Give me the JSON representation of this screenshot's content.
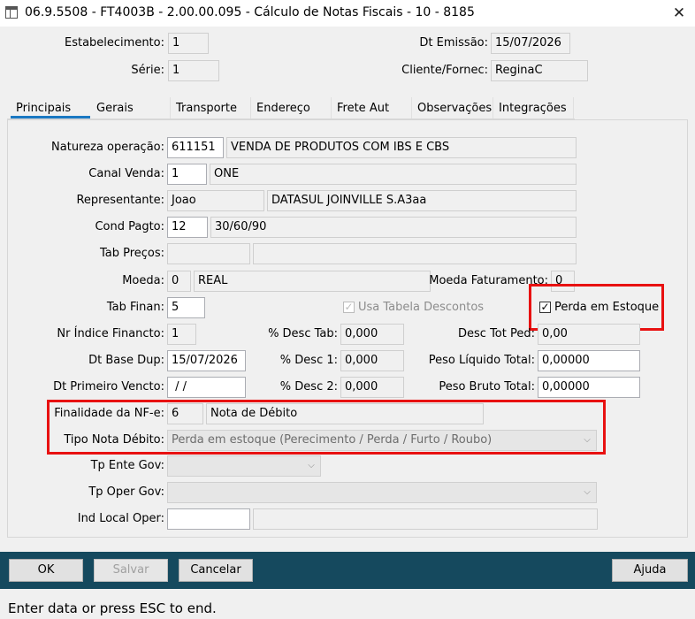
{
  "window": {
    "title": "06.9.5508 - FT4003B - 2.00.00.095 - Cálculo de Notas Fiscais - 10 - 8185",
    "close_glyph": "✕"
  },
  "header": {
    "estabelecimento_label": "Estabelecimento:",
    "estabelecimento": "1",
    "serie_label": "Série:",
    "serie": "1",
    "dt_emissao_label": "Dt Emissão:",
    "dt_emissao": "15/07/2026",
    "cliente_label": "Cliente/Fornec:",
    "cliente": "ReginaC"
  },
  "tabs": [
    "Principais",
    "Gerais",
    "Transporte",
    "Endereço",
    "Frete Aut",
    "Observações",
    "Integrações"
  ],
  "form": {
    "natureza_label": "Natureza operação:",
    "natureza_code": "611151",
    "natureza_desc": "VENDA DE PRODUTOS COM IBS E CBS",
    "canal_label": "Canal Venda:",
    "canal_code": "1",
    "canal_desc": "ONE",
    "representante_label": "Representante:",
    "representante_code": "Joao",
    "representante_desc": "DATASUL JOINVILLE S.A3aa",
    "cond_pagto_label": "Cond Pagto:",
    "cond_pagto_code": "12",
    "cond_pagto_desc": "30/60/90",
    "tab_precos_label": "Tab Preços:",
    "tab_precos_code": "",
    "tab_precos_desc": "",
    "moeda_label": "Moeda:",
    "moeda_code": "0",
    "moeda_desc": "REAL",
    "moeda_fat_label": "Moeda Faturamento:",
    "moeda_fat": "0",
    "tab_finan_label": "Tab Finan:",
    "tab_finan": "5",
    "usa_tabela_label": "Usa Tabela Descontos",
    "perda_estoque_label": "Perda em Estoque",
    "nr_indice_label": "Nr Índice Financto:",
    "nr_indice": "1",
    "desc_tab_label": "% Desc Tab:",
    "desc_tab": "0,000",
    "desc_tot_ped_label": "Desc Tot Ped:",
    "desc_tot_ped": "0,00",
    "dt_base_dup_label": "Dt Base Dup:",
    "dt_base_dup": "15/07/2026",
    "desc1_label": "% Desc 1:",
    "desc1": "0,000",
    "peso_liquido_label": "Peso Líquido Total:",
    "peso_liquido": "0,00000",
    "dt_primeiro_label": "Dt Primeiro Vencto:",
    "dt_primeiro": " / /",
    "desc2_label": "% Desc 2:",
    "desc2": "0,000",
    "peso_bruto_label": "Peso Bruto Total:",
    "peso_bruto": "0,00000",
    "finalidade_label": "Finalidade da NF-e:",
    "finalidade_code": "6",
    "finalidade_desc": "Nota de Débito",
    "tipo_nota_label": "Tipo Nota Débito:",
    "tipo_nota": "Perda em estoque (Perecimento / Perda / Furto / Roubo)",
    "tp_ente_label": "Tp Ente Gov:",
    "tp_ente": "",
    "tp_oper_label": "Tp Oper Gov:",
    "tp_oper": "",
    "ind_local_label": "Ind Local Oper:",
    "ind_local_code": "",
    "ind_local_desc": ""
  },
  "buttons": {
    "ok": "OK",
    "salvar": "Salvar",
    "cancelar": "Cancelar",
    "ajuda": "Ajuda"
  },
  "status": "Enter data or press ESC to end.",
  "colors": {
    "accent_tab": "#1a78c2",
    "highlight": "#e81111",
    "bottom_bar": "#15495e"
  }
}
